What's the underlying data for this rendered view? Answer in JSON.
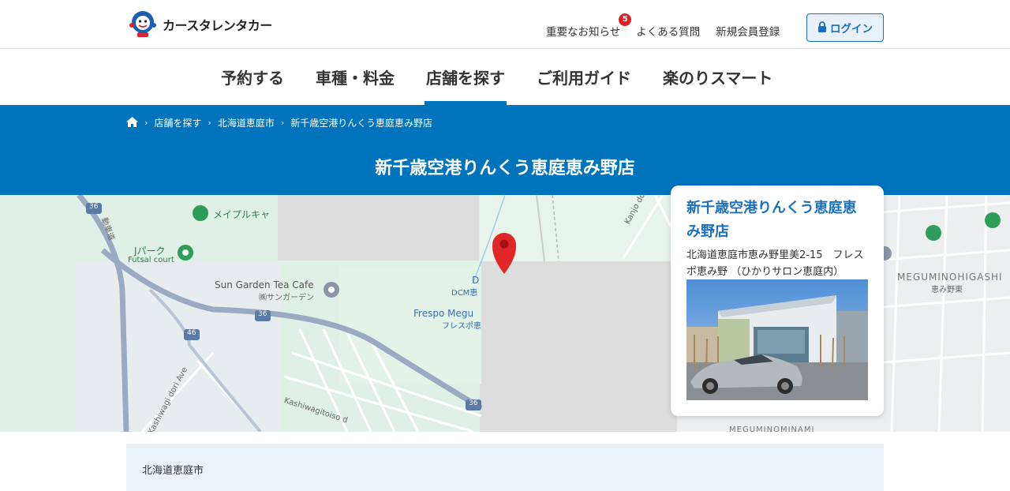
{
  "header": {
    "brand": "カースタレンタカー",
    "links": [
      {
        "label": "重要なお知らせ",
        "badge": "5"
      },
      {
        "label": "よくある質問"
      },
      {
        "label": "新規会員登録"
      }
    ],
    "login_label": "ログイン"
  },
  "nav": {
    "items": [
      {
        "label": "予約する"
      },
      {
        "label": "車種・料金"
      },
      {
        "label": "店舗を探す",
        "active": true
      },
      {
        "label": "ご利用ガイド"
      },
      {
        "label": "楽のりスマート"
      }
    ]
  },
  "breadcrumb": {
    "items": [
      "店舗を探す",
      "北海道恵庭市",
      "新千歳空港りんくう恵庭恵み野店"
    ]
  },
  "page": {
    "title": "新千歳空港りんくう恵庭恵み野店"
  },
  "map": {
    "labels": {
      "maple": "メイプルキャ",
      "jpark": "Jパーク",
      "futsal": "Futsal court",
      "sungarden": "Sun Garden Tea Cafe",
      "sungarden_ja": "㈱サンガーデン",
      "frespo": "Frespo Megu",
      "frespo_ja": "フレスポ恵",
      "dcm_d": "D",
      "dcm": "DCM恵",
      "kanjo": "Kanjo dori Ave",
      "kashiwagi_ave": "Kashiwagi dori Ave",
      "kashiwagitoiso": "Kashiwagitoiso d",
      "meguminohigashi": "MEGUMINOHIGASHI",
      "meguminohigashi_ja": "恵み野東",
      "megumiminami": "MEGUMINOMINAMI",
      "route36": "36",
      "route46": "46",
      "expressway": "動車道"
    }
  },
  "store_card": {
    "name": "新千歳空港りんくう恵庭恵み野店",
    "address": "北海道恵庭市恵み野里美2-15　フレスポ恵み野 （ひかりサロン恵庭内）"
  },
  "section": {
    "region": "北海道恵庭市"
  },
  "colors": {
    "brand_blue": "#0073bd",
    "link_blue": "#1a6fc0",
    "pin_red": "#e02626"
  }
}
